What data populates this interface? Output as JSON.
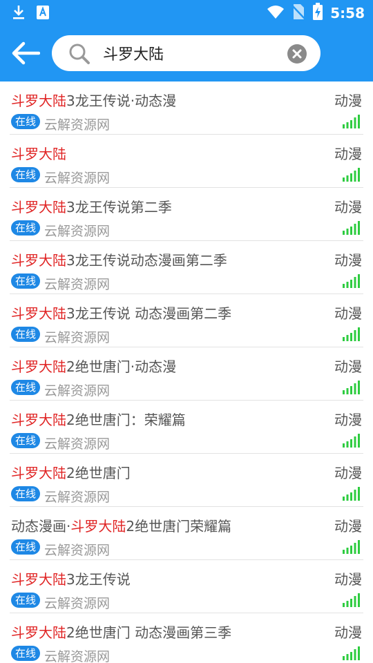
{
  "status_bar": {
    "time": "5:58"
  },
  "search": {
    "query": "斗罗大陆"
  },
  "colors": {
    "header": "#2196F3",
    "highlight": "#e02424",
    "badge": "#1e88e5",
    "signal": "#2ecc40"
  },
  "results": [
    {
      "highlight": "斗罗大陆",
      "prefix": "",
      "suffix": "3龙王传说·动态漫",
      "category": "动漫",
      "badge": "在线",
      "source": "云解资源网"
    },
    {
      "highlight": "斗罗大陆",
      "prefix": "",
      "suffix": "",
      "category": "动漫",
      "badge": "在线",
      "source": "云解资源网"
    },
    {
      "highlight": "斗罗大陆",
      "prefix": "",
      "suffix": "3龙王传说第二季",
      "category": "动漫",
      "badge": "在线",
      "source": "云解资源网"
    },
    {
      "highlight": "斗罗大陆",
      "prefix": "",
      "suffix": "3龙王传说动态漫画第二季",
      "category": "动漫",
      "badge": "在线",
      "source": "云解资源网"
    },
    {
      "highlight": "斗罗大陆",
      "prefix": "",
      "suffix": "3龙王传说 动态漫画第二季",
      "category": "动漫",
      "badge": "在线",
      "source": "云解资源网"
    },
    {
      "highlight": "斗罗大陆",
      "prefix": "",
      "suffix": "2绝世唐门·动态漫",
      "category": "动漫",
      "badge": "在线",
      "source": "云解资源网"
    },
    {
      "highlight": "斗罗大陆",
      "prefix": "",
      "suffix": "2绝世唐门：荣耀篇",
      "category": "动漫",
      "badge": "在线",
      "source": "云解资源网"
    },
    {
      "highlight": "斗罗大陆",
      "prefix": "",
      "suffix": "2绝世唐门",
      "category": "动漫",
      "badge": "在线",
      "source": "云解资源网"
    },
    {
      "highlight": "斗罗大陆",
      "prefix": "动态漫画·",
      "suffix": "2绝世唐门荣耀篇",
      "category": "动漫",
      "badge": "在线",
      "source": "云解资源网"
    },
    {
      "highlight": "斗罗大陆",
      "prefix": "",
      "suffix": "3龙王传说",
      "category": "动漫",
      "badge": "在线",
      "source": "云解资源网"
    },
    {
      "highlight": "斗罗大陆",
      "prefix": "",
      "suffix": "2绝世唐门 动态漫画第三季",
      "category": "动漫",
      "badge": "在线",
      "source": "云解资源网"
    }
  ]
}
